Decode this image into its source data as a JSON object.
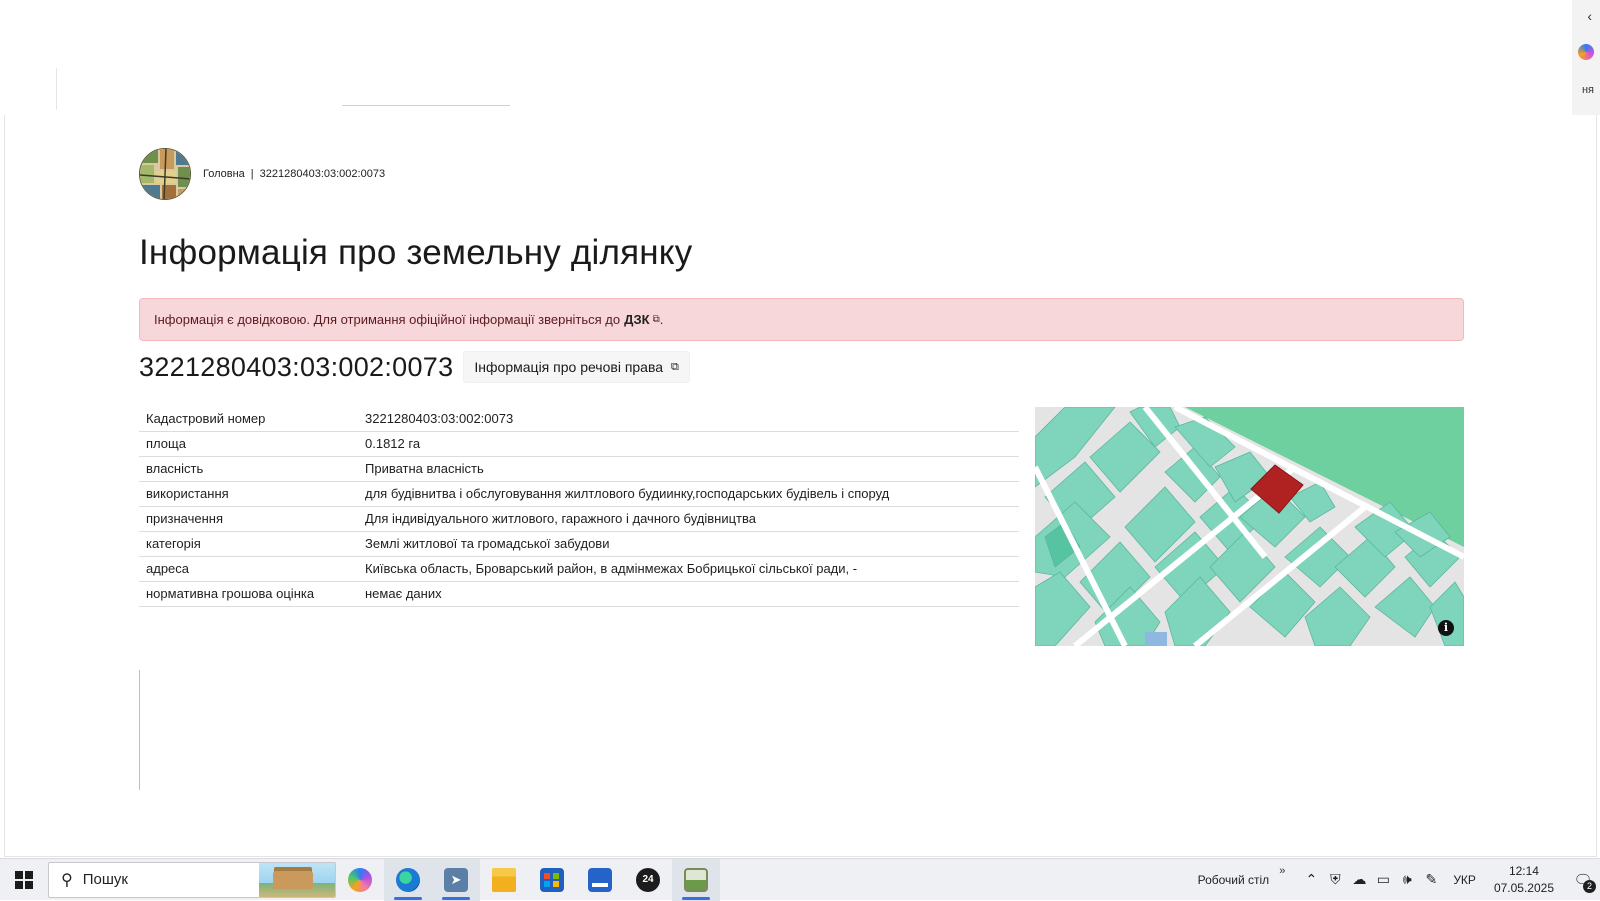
{
  "breadcrumb": {
    "home": "Головна",
    "separator": "|",
    "current": "3221280403:03:002:0073"
  },
  "page": {
    "title": "Інформація про земельну ділянку"
  },
  "alert": {
    "text": "Інформація є довідковою. Для отримання офіційної інформації зверніться до",
    "link_label": "ДЗК",
    "link_icon": "external-link-icon",
    "trailing": "."
  },
  "parcel": {
    "cadastral_number": "3221280403:03:002:0073",
    "rights_button_label": "Інформація про речові права"
  },
  "info_table": [
    {
      "key": "Кадастровий номер",
      "value": "3221280403:03:002:0073"
    },
    {
      "key": "площа",
      "value": "0.1812 га"
    },
    {
      "key": "власність",
      "value": "Приватна власність"
    },
    {
      "key": "використання",
      "value": "для будівнитва і обслуговування жилтлового будиинку,господарських будівель і споруд"
    },
    {
      "key": "призначення",
      "value": "Для індивідуального житлового, гаражного і дачного будівництва"
    },
    {
      "key": "категорія",
      "value": "Землі житлової та громадської забудови"
    },
    {
      "key": "адреса",
      "value": "Київська область, Броварський район, в адмінмежах Бобрицької сільської ради, -"
    },
    {
      "key": "нормативна грошова оцінка",
      "value": "немає даних"
    }
  ],
  "map": {
    "info_button": "i",
    "colors": {
      "parcel": "#7fd4bc",
      "selected": "#b02222",
      "road": "#e4e4e4",
      "forest": "#6ecf9f"
    }
  },
  "taskbar": {
    "search_placeholder": "Пошук",
    "apps": [
      "copilot-icon",
      "edge-icon",
      "telegram-icon",
      "file-explorer-icon",
      "store-icon",
      "scanner-icon",
      "app-24-icon",
      "photos-icon"
    ],
    "desktop_label": "Робочий стіл",
    "chevrons": "»",
    "language": "УКР",
    "time": "12:14",
    "date": "07.05.2025",
    "notifications_count": "2"
  },
  "side_panel": {
    "label": "ня"
  }
}
